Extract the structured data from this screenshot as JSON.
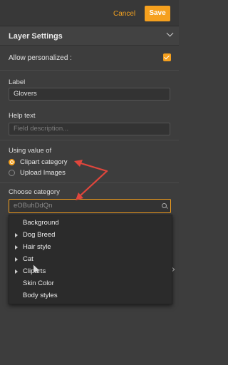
{
  "header": {
    "cancel_label": "Cancel",
    "save_label": "Save"
  },
  "section": {
    "title": "Layer Settings"
  },
  "allow_personalized": {
    "label": "Allow personalized :",
    "checked": true
  },
  "label_field": {
    "label": "Label",
    "value": "Glovers"
  },
  "help_text": {
    "label": "Help text",
    "placeholder": "Field description..."
  },
  "using_value": {
    "label": "Using value of",
    "options": [
      {
        "label": "Clipart category",
        "selected": true
      },
      {
        "label": "Upload Images",
        "selected": false
      }
    ]
  },
  "choose_category": {
    "label": "Choose category",
    "search_value": "eOBuhDdQn",
    "items": [
      {
        "label": "Background",
        "has_children": false
      },
      {
        "label": "Dog Breed",
        "has_children": true
      },
      {
        "label": "Hair style",
        "has_children": true
      },
      {
        "label": "Cat",
        "has_children": true
      },
      {
        "label": "Cliparts",
        "has_children": true
      },
      {
        "label": "Skin Color",
        "has_children": false
      },
      {
        "label": "Body styles",
        "has_children": false
      }
    ]
  },
  "colors": {
    "accent": "#f5a01e",
    "annotation": "#e0463c"
  }
}
